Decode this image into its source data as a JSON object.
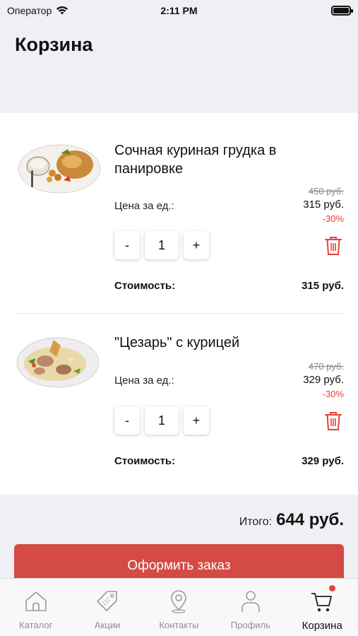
{
  "status_bar": {
    "carrier": "Оператор",
    "time": "2:11 PM"
  },
  "header": {
    "title": "Корзина"
  },
  "items": [
    {
      "name": "Сочная куриная грудка в панировке",
      "price_label": "Цена за ед.:",
      "old_price": "450 руб.",
      "new_price": "315 руб.",
      "discount": "-30%",
      "minus_label": "-",
      "quantity": "1",
      "plus_label": "+",
      "cost_label": "Стоимость:",
      "cost_value": "315 руб."
    },
    {
      "name": "\"Цезарь\" с курицей",
      "price_label": "Цена за ед.:",
      "old_price": "470 руб.",
      "new_price": "329 руб.",
      "discount": "-30%",
      "minus_label": "-",
      "quantity": "1",
      "plus_label": "+",
      "cost_label": "Стоимость:",
      "cost_value": "329 руб."
    }
  ],
  "summary": {
    "total_label": "Итого:",
    "total_value": "644 руб."
  },
  "checkout": {
    "label": "Оформить заказ"
  },
  "tabs": [
    {
      "label": "Каталог",
      "icon": "home-icon",
      "active": false
    },
    {
      "label": "Акции",
      "icon": "tag-icon",
      "active": false
    },
    {
      "label": "Контакты",
      "icon": "map-pin-icon",
      "active": false
    },
    {
      "label": "Профиль",
      "icon": "user-icon",
      "active": false
    },
    {
      "label": "Корзина",
      "icon": "cart-icon",
      "active": true
    }
  ],
  "colors": {
    "accent": "#d44b45",
    "discount": "#e0433c",
    "tab_inactive": "#8e8e8e"
  }
}
